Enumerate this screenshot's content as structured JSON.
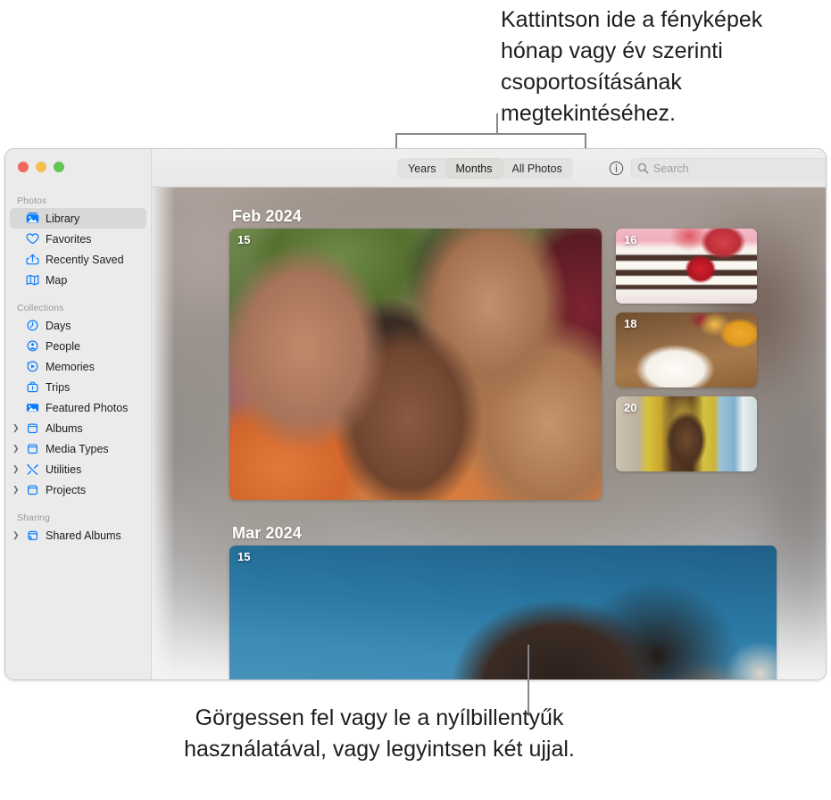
{
  "callouts": {
    "top": "Kattintson ide a fényképek hónap vagy év szerinti csoportosításának megtekintéséhez.",
    "bottom": "Görgessen fel vagy le a nyílbillentyűk használatával, vagy legyintsen két ujjal."
  },
  "window": {
    "traffic_lights": [
      "close",
      "minimize",
      "zoom"
    ]
  },
  "sidebar": {
    "sections": [
      {
        "title": "Photos",
        "items": [
          {
            "label": "Library",
            "icon": "photos-library-icon",
            "selected": true,
            "disclosure": false
          },
          {
            "label": "Favorites",
            "icon": "heart-icon",
            "selected": false,
            "disclosure": false
          },
          {
            "label": "Recently Saved",
            "icon": "recently-saved-icon",
            "selected": false,
            "disclosure": false
          },
          {
            "label": "Map",
            "icon": "map-icon",
            "selected": false,
            "disclosure": false
          }
        ]
      },
      {
        "title": "Collections",
        "items": [
          {
            "label": "Days",
            "icon": "clock-icon",
            "selected": false,
            "disclosure": false
          },
          {
            "label": "People",
            "icon": "person-circle-icon",
            "selected": false,
            "disclosure": false
          },
          {
            "label": "Memories",
            "icon": "memories-play-icon",
            "selected": false,
            "disclosure": false
          },
          {
            "label": "Trips",
            "icon": "suitcase-icon",
            "selected": false,
            "disclosure": false
          },
          {
            "label": "Featured Photos",
            "icon": "featured-photo-icon",
            "selected": false,
            "disclosure": false
          },
          {
            "label": "Albums",
            "icon": "album-box-icon",
            "selected": false,
            "disclosure": true
          },
          {
            "label": "Media Types",
            "icon": "album-box-icon",
            "selected": false,
            "disclosure": true
          },
          {
            "label": "Utilities",
            "icon": "tools-icon",
            "selected": false,
            "disclosure": true
          },
          {
            "label": "Projects",
            "icon": "album-box-icon",
            "selected": false,
            "disclosure": true
          }
        ]
      },
      {
        "title": "Sharing",
        "items": [
          {
            "label": "Shared Albums",
            "icon": "shared-album-icon",
            "selected": false,
            "disclosure": true
          }
        ]
      }
    ]
  },
  "toolbar": {
    "segments": [
      {
        "label": "Years",
        "active": false
      },
      {
        "label": "Months",
        "active": true
      },
      {
        "label": "All Photos",
        "active": false
      }
    ],
    "info_icon": "info-circle-icon",
    "search": {
      "icon": "search-icon",
      "placeholder": "Search",
      "value": ""
    }
  },
  "library": {
    "months": [
      {
        "heading": "Feb 2024",
        "tiles": [
          {
            "day": "15",
            "size": "large",
            "subject": "group-selfie"
          },
          {
            "day": "16",
            "size": "small",
            "subject": "strawberry-cake"
          },
          {
            "day": "18",
            "size": "small",
            "subject": "plated-food"
          },
          {
            "day": "20",
            "size": "small",
            "subject": "beach-portrait"
          }
        ]
      },
      {
        "heading": "Mar 2024",
        "tiles": [
          {
            "day": "15",
            "size": "wide",
            "subject": "blue-backdrop-portrait"
          }
        ]
      }
    ]
  },
  "colors": {
    "accent": "#0a7cff",
    "selected_row": "#d8d8d8",
    "sidebar_bg": "#ebebeb",
    "leader_line": "#86868b",
    "text": "#1d1d1f"
  }
}
